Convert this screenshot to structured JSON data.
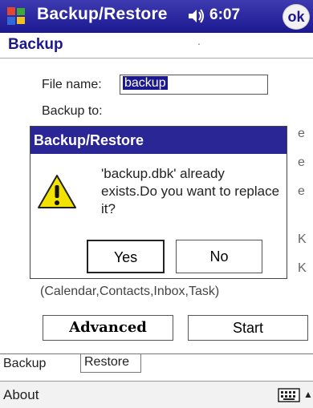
{
  "title_bar": {
    "app_title": "Backup/Restore",
    "time": "6:07",
    "ok_label": "ok"
  },
  "page": {
    "heading": "Backup",
    "heading_dot": "."
  },
  "form": {
    "file_name_label": "File name:",
    "file_name_value": "backup",
    "backup_to_label": "Backup to:",
    "items_text": "(Calendar,Contacts,Inbox,Task)"
  },
  "buttons": {
    "advanced": "Advanced",
    "start": "Start"
  },
  "tabs": [
    {
      "label": "Backup"
    },
    {
      "label": "Restore"
    }
  ],
  "menu": {
    "about": "About"
  },
  "dialog": {
    "title": "Backup/Restore",
    "message": "'backup.dbk' already exists.Do you want to replace it?",
    "yes": "Yes",
    "no": "No"
  },
  "partial_glyphs": [
    "e",
    "e",
    "e",
    "K",
    "K"
  ],
  "colors": {
    "title_bar": "#1c1890",
    "dialog_title": "#2a2696",
    "warning": "#f2e200"
  },
  "icons": {
    "start": "windows-flag-icon",
    "volume": "speaker-icon",
    "warning": "warning-icon",
    "keyboard": "keyboard-icon",
    "arrow": "up-arrow-icon"
  }
}
